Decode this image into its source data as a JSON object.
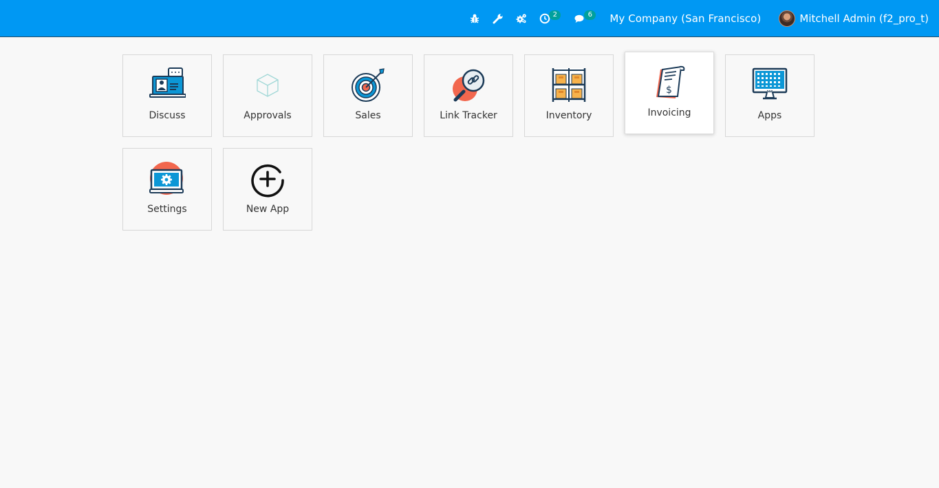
{
  "navbar": {
    "systray": {
      "debug_icon": "bug-icon",
      "tools_icon": "wrench-icon",
      "settings_icon": "gears-icon",
      "activity_icon": "clock-icon",
      "activity_count": "2",
      "messaging_icon": "comments-icon",
      "messaging_count": "6"
    },
    "company": "My Company (San Francisco)",
    "user_name": "Mitchell Admin (f2_pro_t)"
  },
  "apps": [
    {
      "label": "Discuss",
      "icon": "discuss-icon"
    },
    {
      "label": "Approvals",
      "icon": "approvals-icon"
    },
    {
      "label": "Sales",
      "icon": "sales-icon"
    },
    {
      "label": "Link Tracker",
      "icon": "link-tracker-icon"
    },
    {
      "label": "Inventory",
      "icon": "inventory-icon"
    },
    {
      "label": "Invoicing",
      "icon": "invoicing-icon"
    },
    {
      "label": "Apps",
      "icon": "apps-icon"
    },
    {
      "label": "Settings",
      "icon": "settings-icon"
    },
    {
      "label": "New App",
      "icon": "new-app-icon"
    }
  ],
  "colors": {
    "navbar": "#0098f3",
    "badge": "#00a09d",
    "background": "#f8f8f8"
  }
}
